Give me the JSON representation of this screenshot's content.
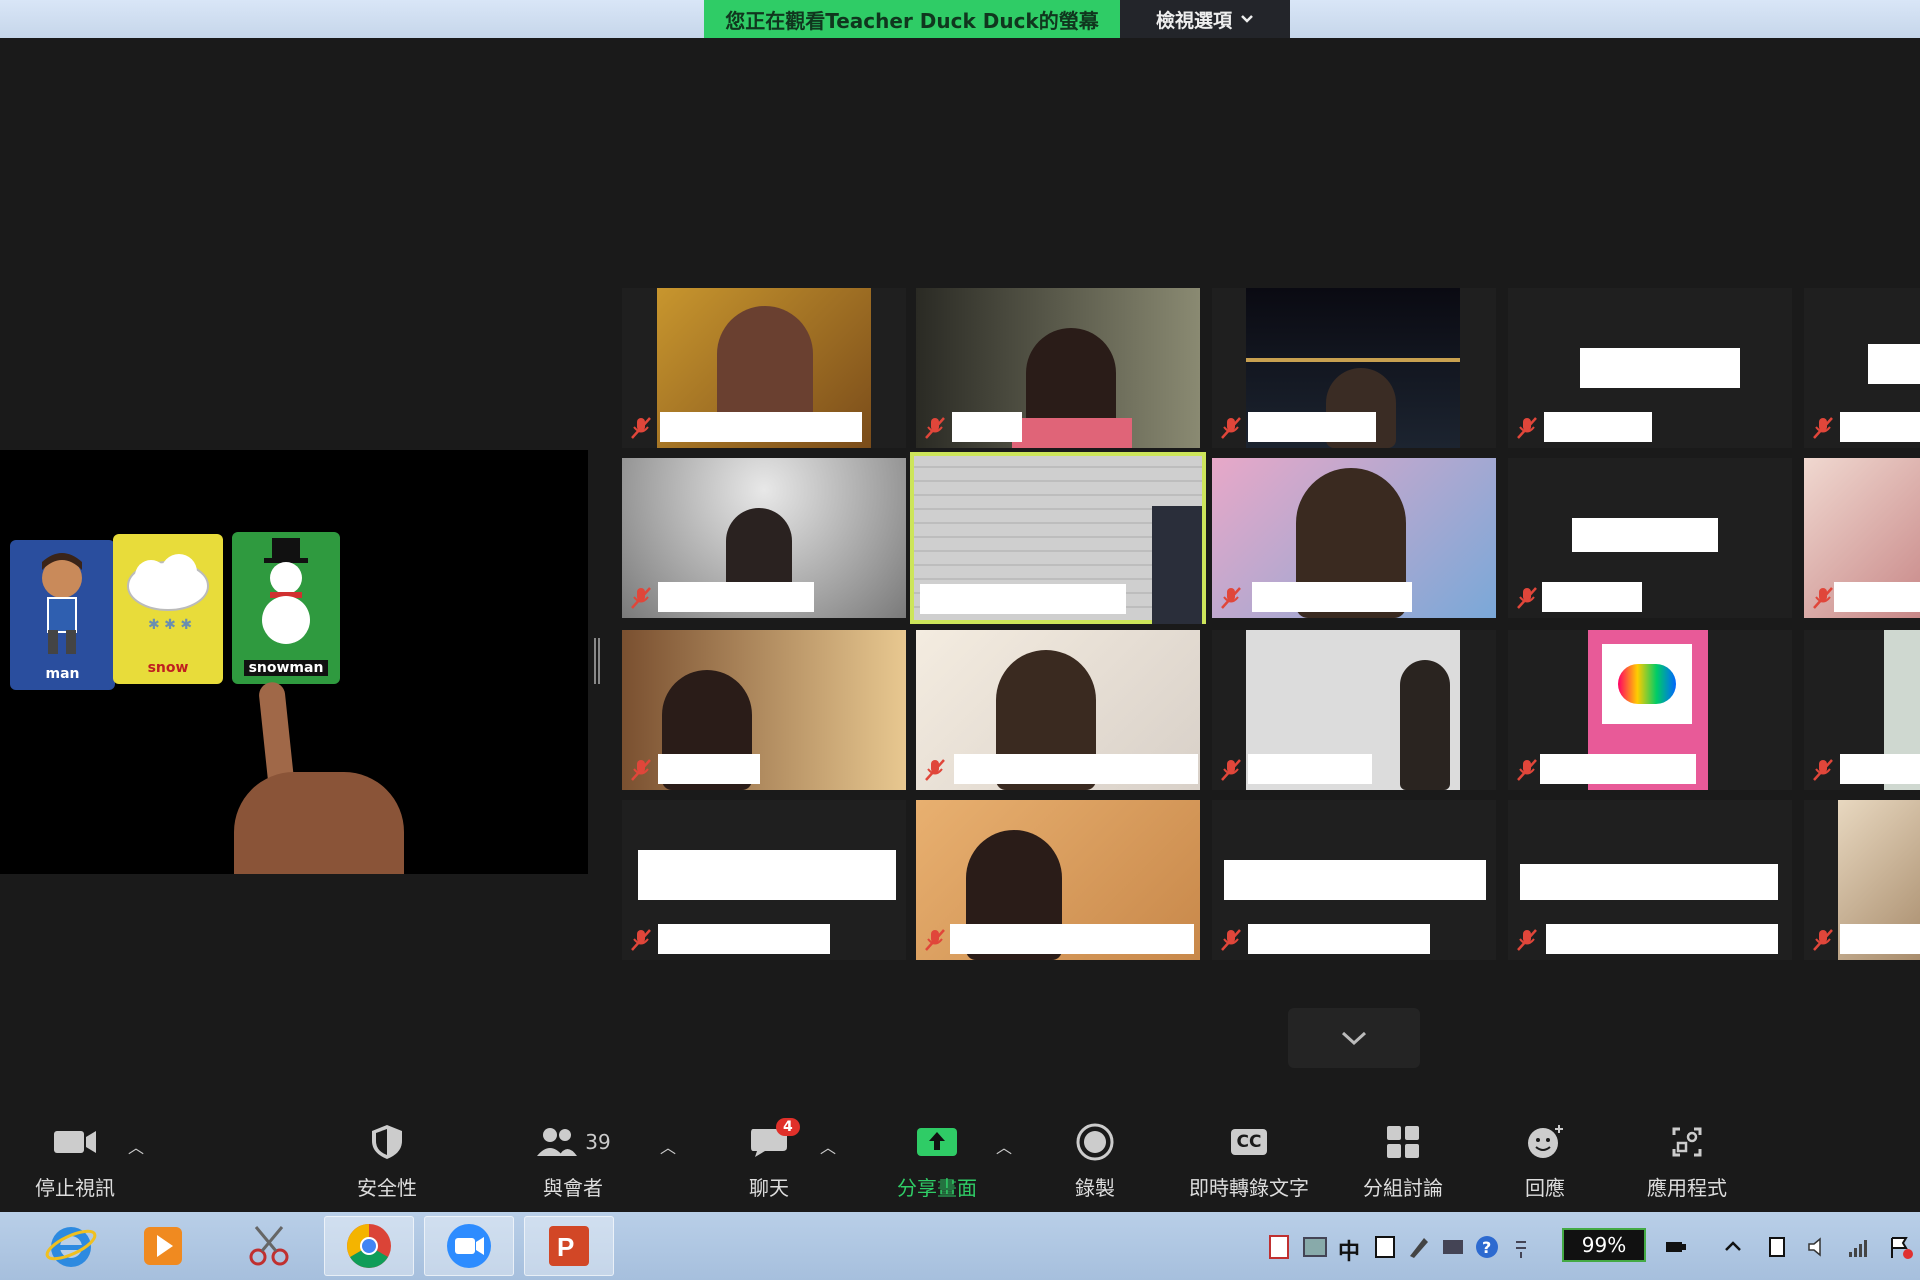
{
  "banner": {
    "text": "您正在觀看Teacher  Duck  Duck的螢幕",
    "view_options": "檢視選項"
  },
  "shared_screen": {
    "cards": [
      {
        "label": "man"
      },
      {
        "label": "snow"
      },
      {
        "label": "snowman"
      }
    ]
  },
  "toolbar": {
    "stop_video": "停止視訊",
    "security": "安全性",
    "participants": "與會者",
    "participants_count": "39",
    "chat": "聊天",
    "chat_badge": "4",
    "share_screen": "分享畫面",
    "record": "錄製",
    "live_transcript": "即時轉錄文字",
    "cc_text": "CC",
    "breakout": "分組討論",
    "reactions": "回應",
    "apps": "應用程式"
  },
  "taskbar": {
    "battery": "99%",
    "ime": "中"
  },
  "colors": {
    "accent_green": "#2fcc66",
    "active_speaker": "#cde55a",
    "mute_red": "#e0463a"
  }
}
